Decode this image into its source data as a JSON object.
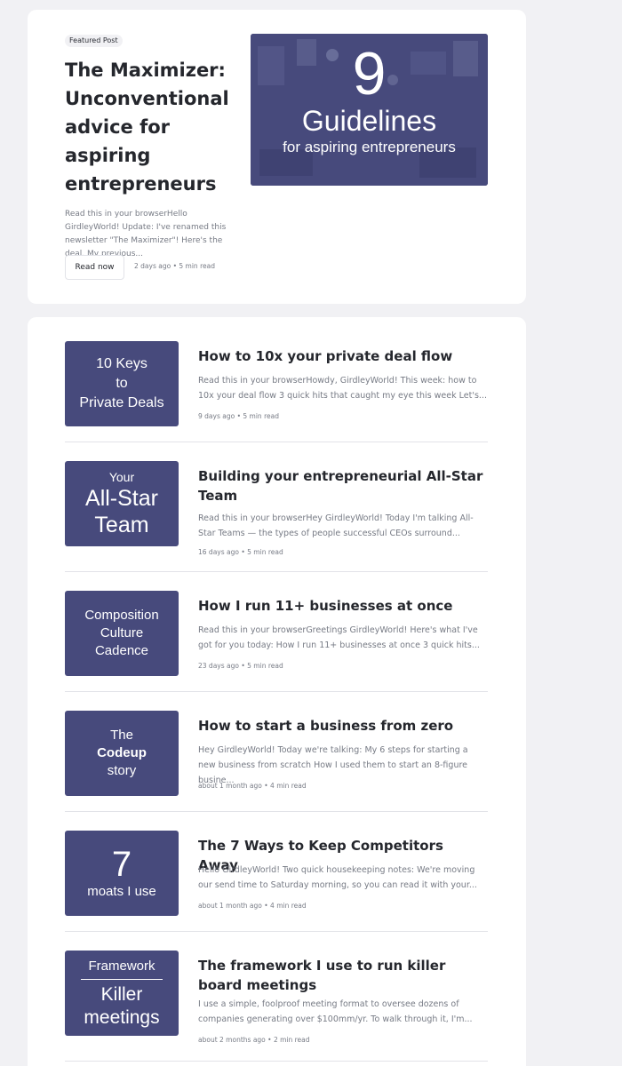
{
  "featured": {
    "badge": "Featured Post",
    "title": "The Maximizer: Unconventional advice for aspiring entrepreneurs",
    "excerpt": "Read this in your browserHello GirdleyWorld! Update: I've renamed this newsletter \"The Maximizer\"! Here's the deal. My previous...",
    "button_label": "Read now",
    "meta": "2 days ago • 5 min read",
    "image": {
      "number": "9",
      "word": "Guidelines",
      "subline": "for aspiring entrepreneurs"
    }
  },
  "posts": [
    {
      "title": "How to 10x your private deal flow",
      "excerpt": "Read this in your browserHowdy, GirdleyWorld! This week: how to 10x your deal flow 3 quick hits that caught my eye this week Let's...",
      "meta": "9 days ago • 5 min read",
      "thumb": [
        "10 Keys",
        "to",
        "Private Deals"
      ]
    },
    {
      "title": "Building your entrepreneurial All-Star Team",
      "excerpt": "Read this in your browserHey GirdleyWorld! Today I'm talking All-Star Teams — the types of people successful CEOs surround...",
      "meta": "16 days ago • 5 min read",
      "thumb": [
        "Your",
        "All-Star",
        "Team"
      ]
    },
    {
      "title": "How I run 11+ businesses at once",
      "excerpt": "Read this in your browserGreetings GirdleyWorld! Here's what I've got for you today: How I run 11+ businesses at once 3 quick hits...",
      "meta": "23 days ago • 5 min read",
      "thumb": [
        "Composition",
        "Culture",
        "Cadence"
      ]
    },
    {
      "title": "How to start a business from zero",
      "excerpt": "Hey GirdleyWorld! Today we're talking: My 6 steps for starting a new business from scratch How I used them to start an 8-figure busine...",
      "meta": "about 1 month ago • 4 min read",
      "thumb": [
        "The",
        "Codeup",
        "story"
      ]
    },
    {
      "title": "The 7 Ways to Keep Competitors Away",
      "excerpt": "Hello GirdleyWorld! Two quick housekeeping notes: We're moving our send time to Saturday morning, so you can read it with your...",
      "meta": "about 1 month ago • 4 min read",
      "thumb": [
        "7",
        "moats I use"
      ]
    },
    {
      "title": "The framework I use to run killer board meetings",
      "excerpt": "I use a simple, foolproof meeting format to oversee dozens of companies generating over $100mm/yr. To walk through it, I'm...",
      "meta": "about 2 months ago • 2 min read",
      "thumb": [
        "Framework",
        "Killer",
        "meetings"
      ]
    }
  ]
}
